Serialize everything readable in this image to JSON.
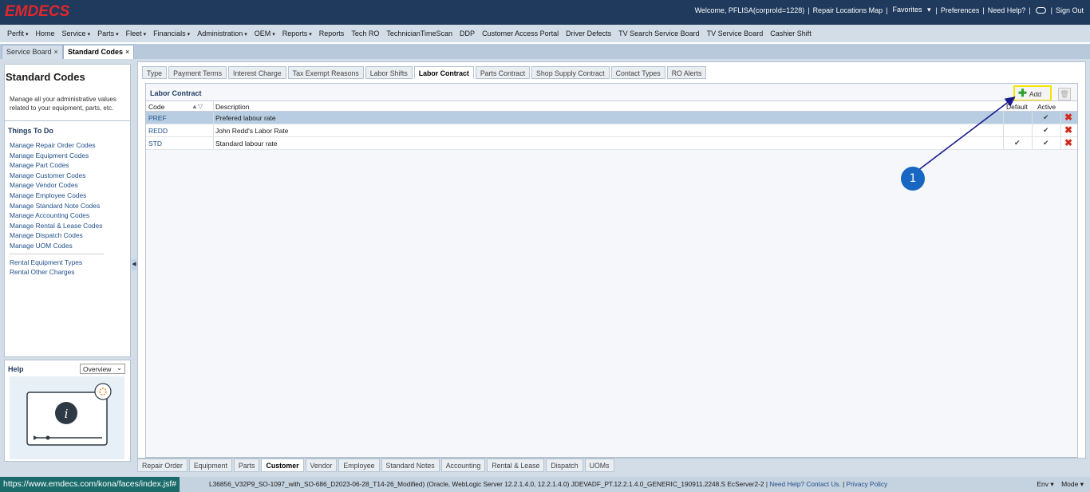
{
  "header": {
    "logo": "EMDECS",
    "welcome": "Welcome, PFLISA(corproId=1228)",
    "repair_locations": "Repair Locations Map",
    "favorites": "Favorites",
    "preferences": "Preferences",
    "need_help": "Need Help?",
    "sign_out": "Sign Out"
  },
  "menu": [
    {
      "label": "Perfit",
      "dropdown": true
    },
    {
      "label": "Home",
      "dropdown": false
    },
    {
      "label": "Service",
      "dropdown": true
    },
    {
      "label": "Parts",
      "dropdown": true
    },
    {
      "label": "Fleet",
      "dropdown": true
    },
    {
      "label": "Financials",
      "dropdown": true
    },
    {
      "label": "Administration",
      "dropdown": true
    },
    {
      "label": "OEM",
      "dropdown": true
    },
    {
      "label": "Reports",
      "dropdown": true
    },
    {
      "label": "Reports",
      "dropdown": false
    },
    {
      "label": "Tech RO",
      "dropdown": false
    },
    {
      "label": "TechnicianTimeScan",
      "dropdown": false
    },
    {
      "label": "DDP",
      "dropdown": false
    },
    {
      "label": "Customer Access Portal",
      "dropdown": false
    },
    {
      "label": "Driver Defects",
      "dropdown": false
    },
    {
      "label": "TV Search Service Board",
      "dropdown": false
    },
    {
      "label": "TV Service Board",
      "dropdown": false
    },
    {
      "label": "Cashier Shift",
      "dropdown": false
    }
  ],
  "page_tabs": [
    {
      "label": "Service Board",
      "active": false
    },
    {
      "label": "Standard Codes",
      "active": true
    }
  ],
  "close_glyph": "×",
  "left": {
    "title": "Standard Codes",
    "description": "Manage all your administrative values related to your equipment, parts, etc.",
    "todo_title": "Things To Do",
    "todo_links": [
      "Manage Repair Order Codes",
      "Manage Equipment Codes",
      "Manage Part Codes",
      "Manage Customer Codes",
      "Manage Vendor Codes",
      "Manage Employee Codes",
      "Manage Standard Note Codes",
      "Manage Accounting Codes",
      "Manage Rental & Lease Codes",
      "Manage Dispatch Codes",
      "Manage UOM Codes"
    ],
    "extra_links": [
      "Rental Equipment Types",
      "Rental Other Charges"
    ],
    "help_title": "Help",
    "help_select": "Overview"
  },
  "subtabs": [
    {
      "label": "Type",
      "active": false
    },
    {
      "label": "Payment Terms",
      "active": false
    },
    {
      "label": "Interest Charge",
      "active": false
    },
    {
      "label": "Tax Exempt Reasons",
      "active": false
    },
    {
      "label": "Labor Shifts",
      "active": false
    },
    {
      "label": "Labor Contract",
      "active": true
    },
    {
      "label": "Parts Contract",
      "active": false
    },
    {
      "label": "Shop Supply Contract",
      "active": false
    },
    {
      "label": "Contact Types",
      "active": false
    },
    {
      "label": "RO Alerts",
      "active": false
    }
  ],
  "labor_contract": {
    "title": "Labor Contract",
    "add_label": "Add",
    "columns": {
      "code": "Code",
      "description": "Description",
      "default": "Default",
      "active": "Active"
    },
    "rows": [
      {
        "code": "PREF",
        "description": "Prefered labour rate",
        "default": false,
        "active": true,
        "selected": true
      },
      {
        "code": "REDD",
        "description": "John Redd's Labor Rate",
        "default": false,
        "active": true,
        "selected": false
      },
      {
        "code": "STD",
        "description": "Standard labour rate",
        "default": true,
        "active": true,
        "selected": false
      }
    ]
  },
  "annotation": {
    "number": "1"
  },
  "bottom_tabs": [
    {
      "label": "Repair Order",
      "active": false
    },
    {
      "label": "Equipment",
      "active": false
    },
    {
      "label": "Parts",
      "active": false
    },
    {
      "label": "Customer",
      "active": true
    },
    {
      "label": "Vendor",
      "active": false
    },
    {
      "label": "Employee",
      "active": false
    },
    {
      "label": "Standard Notes",
      "active": false
    },
    {
      "label": "Accounting",
      "active": false
    },
    {
      "label": "Rental & Lease",
      "active": false
    },
    {
      "label": "Dispatch",
      "active": false
    },
    {
      "label": "UOMs",
      "active": false
    }
  ],
  "status": {
    "url": "https://www.emdecs.com/kona/faces/index.jsf#",
    "build": "L36856_V32P9_SO-1097_with_SO-686_D2023-06-28_T14-26_Modified) (Oracle, WebLogic Server 12.2.1.4.0, 12.2.1.4.0) JDEVADF_PT.12.2.1.4.0_GENERIC_190911.2248.S EcServer2-2",
    "help_link": "Need Help? Contact Us.",
    "privacy": "Privacy Policy",
    "env": "Env",
    "mode": "Mode"
  },
  "colors": {
    "header_bg": "#1f3a5c",
    "logo_red": "#e2262c",
    "highlight_yellow": "#f3e600",
    "annotation_blue": "#1666c2",
    "selected_row": "#b8cde2",
    "delete_red": "#d42a1e"
  }
}
